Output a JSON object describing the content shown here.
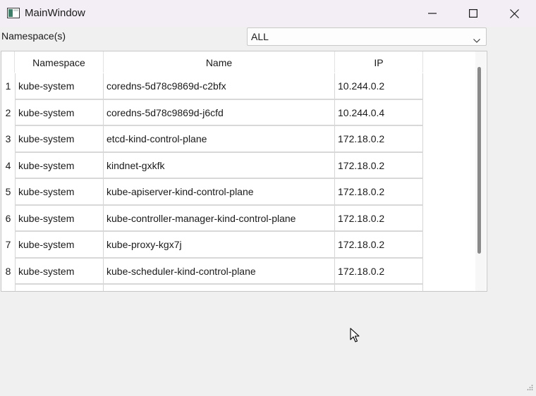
{
  "window": {
    "title": "MainWindow"
  },
  "filter": {
    "label": "Namespace(s)",
    "selected": "ALL"
  },
  "table": {
    "columns": [
      "Namespace",
      "Name",
      "IP"
    ],
    "rows": [
      {
        "num": "1",
        "namespace": "kube-system",
        "name": "coredns-5d78c9869d-c2bfx",
        "ip": "10.244.0.2"
      },
      {
        "num": "2",
        "namespace": "kube-system",
        "name": "coredns-5d78c9869d-j6cfd",
        "ip": "10.244.0.4"
      },
      {
        "num": "3",
        "namespace": "kube-system",
        "name": "etcd-kind-control-plane",
        "ip": "172.18.0.2"
      },
      {
        "num": "4",
        "namespace": "kube-system",
        "name": "kindnet-gxkfk",
        "ip": "172.18.0.2"
      },
      {
        "num": "5",
        "namespace": "kube-system",
        "name": "kube-apiserver-kind-control-plane",
        "ip": "172.18.0.2"
      },
      {
        "num": "6",
        "namespace": "kube-system",
        "name": "kube-controller-manager-kind-control-plane",
        "ip": "172.18.0.2"
      },
      {
        "num": "7",
        "namespace": "kube-system",
        "name": "kube-proxy-kgx7j",
        "ip": "172.18.0.2"
      },
      {
        "num": "8",
        "namespace": "kube-system",
        "name": "kube-scheduler-kind-control-plane",
        "ip": "172.18.0.2"
      }
    ]
  },
  "icons": {
    "app": "app-window-icon",
    "minimize": "minimize-icon",
    "maximize": "maximize-icon",
    "close": "close-icon",
    "dropdown": "chevron-down-icon",
    "cursor": "mouse-pointer-icon",
    "resize": "resize-grip-icon"
  }
}
